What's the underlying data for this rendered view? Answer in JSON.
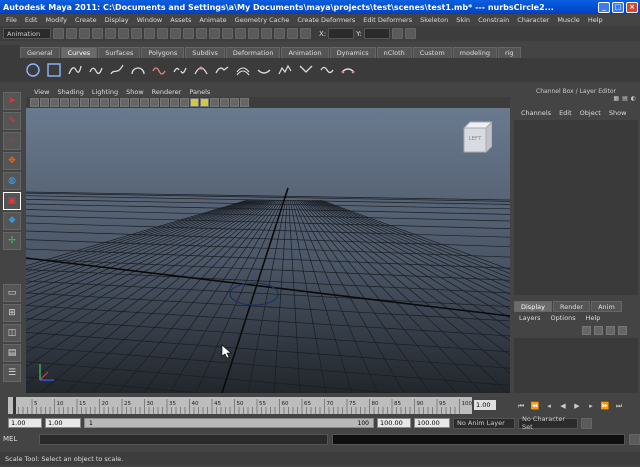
{
  "title": "Autodesk Maya 2011: C:\\Documents and Settings\\a\\My Documents\\maya\\projects\\test\\scenes\\test1.mb*   ---   nurbsCircle2...",
  "menu": [
    "File",
    "Edit",
    "Modify",
    "Create",
    "Display",
    "Window",
    "Assets",
    "Animate",
    "Geometry Cache",
    "Create Deformers",
    "Edit Deformers",
    "Skeleton",
    "Skin",
    "Constrain",
    "Character",
    "Muscle",
    "Help"
  ],
  "status": {
    "mode": "Animation",
    "x_label": "X:",
    "y_label": "Y:"
  },
  "shelf_tabs": [
    "General",
    "Curves",
    "Surfaces",
    "Polygons",
    "Subdivs",
    "Deformation",
    "Animation",
    "Dynamics",
    "nCloth",
    "Custom",
    "modeling",
    "rig"
  ],
  "panel_menu": [
    "View",
    "Shading",
    "Lighting",
    "Show",
    "Renderer",
    "Panels"
  ],
  "viewcube_label": "LEFT",
  "channel_box": {
    "header": "Channel Box / Layer Editor",
    "menu": [
      "Channels",
      "Edit",
      "Object",
      "Show"
    ]
  },
  "layer_tabs": [
    "Display",
    "Render",
    "Anim"
  ],
  "layer_menu": [
    "Layers",
    "Options",
    "Help"
  ],
  "time_ticks": [
    "5",
    "10",
    "15",
    "20",
    "25",
    "30",
    "35",
    "40",
    "45",
    "50",
    "55",
    "60",
    "65",
    "70",
    "75",
    "80",
    "85",
    "90",
    "95",
    "100"
  ],
  "current_time": "1.00",
  "range": {
    "start": "1.00",
    "start2": "1.00",
    "slider_start": "1",
    "slider_end": "100",
    "end": "100.00",
    "end2": "100.00",
    "anim_layer": "No Anim Layer",
    "char_set": "No Character Set"
  },
  "mel_label": "MEL",
  "help_text": "Scale Tool: Select an object to scale."
}
